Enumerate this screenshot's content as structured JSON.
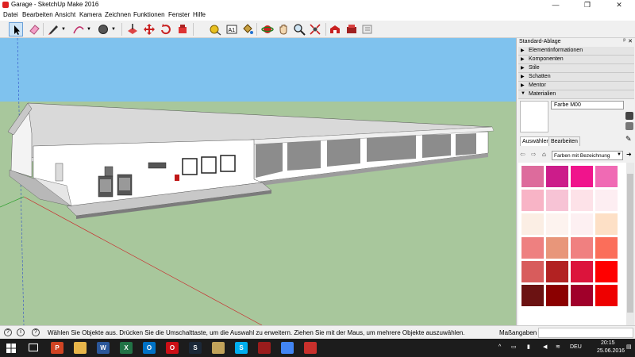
{
  "window": {
    "title": "Garage - SketchUp Make 2016",
    "minimize": "—",
    "maximize": "❐",
    "close": "✕"
  },
  "menu": [
    "Datei",
    "Bearbeiten",
    "Ansicht",
    "Kamera",
    "Zeichnen",
    "Funktionen",
    "Fenster",
    "Hilfe"
  ],
  "toolbar": {
    "tools": [
      "select-tool",
      "eraser-tool",
      "line-tool",
      "arc-tool",
      "shapes-tool",
      "push-pull-tool",
      "move-tool",
      "rotate-tool",
      "follow-me-tool",
      "tape-measure-tool",
      "text-tool",
      "paint-bucket-tool",
      "orbit-tool",
      "pan-tool",
      "zoom-tool",
      "zoom-extents-tool",
      "warehouse-tool",
      "extension-warehouse-tool",
      "layout-tool"
    ],
    "text_tool_label": "A1"
  },
  "tray": {
    "title": "Standard-Ablage",
    "pin": "ᵖ",
    "close": "✕",
    "sections": [
      {
        "label": "Elementinformationen",
        "state": "collapsed"
      },
      {
        "label": "Komponenten",
        "state": "collapsed"
      },
      {
        "label": "Stile",
        "state": "collapsed"
      },
      {
        "label": "Schatten",
        "state": "collapsed"
      },
      {
        "label": "Mentor",
        "state": "collapsed"
      },
      {
        "label": "Materialien",
        "state": "expanded"
      }
    ],
    "material_name": "Farbe M00",
    "tabs": [
      "Auswählen",
      "Bearbeiten"
    ],
    "library": "Farben mit Bezeichnung",
    "swatches": [
      "#dd6b9c",
      "#cc1c8a",
      "#f0148c",
      "#f06ab4",
      "#f8b4c6",
      "#f7c3d5",
      "#fde2e8",
      "#fdeef2",
      "#fbeee4",
      "#fdf3ef",
      "#fdf0f2",
      "#fde0c6",
      "#ee8080",
      "#e8967a",
      "#f08080",
      "#fb6e5a",
      "#d85c5c",
      "#b22222",
      "#dc143c",
      "#ff0000",
      "#6b1212",
      "#8b0000",
      "#a0002a",
      "#ee0000"
    ]
  },
  "status": {
    "text": "Wählen Sie Objekte aus. Drücken Sie die Umschalttaste, um die Auswahl zu erweitern. Ziehen Sie mit der Maus, um mehrere Objekte auszuwählen.",
    "measure_label": "Maßangaben",
    "help_glyph": "?",
    "info_glyph": "i"
  },
  "taskbar": {
    "time": "20:15",
    "date": "25.06.2016",
    "lang": "DEU",
    "apps": [
      {
        "name": "powerpoint",
        "color": "#d04423",
        "glyph": "P"
      },
      {
        "name": "file-explorer",
        "color": "#e8b64a",
        "glyph": ""
      },
      {
        "name": "word",
        "color": "#2b579a",
        "glyph": "W"
      },
      {
        "name": "excel",
        "color": "#217346",
        "glyph": "X"
      },
      {
        "name": "outlook",
        "color": "#0072c6",
        "glyph": "O"
      },
      {
        "name": "opera",
        "color": "#cc0f16",
        "glyph": "O"
      },
      {
        "name": "steam",
        "color": "#1b2838",
        "glyph": "S"
      },
      {
        "name": "paint",
        "color": "#c2a35a",
        "glyph": ""
      },
      {
        "name": "skype",
        "color": "#00aff0",
        "glyph": "S"
      },
      {
        "name": "app-red",
        "color": "#9a1c1c",
        "glyph": ""
      },
      {
        "name": "chrome",
        "color": "#4285f4",
        "glyph": ""
      },
      {
        "name": "sketchup",
        "color": "#c9302c",
        "glyph": ""
      }
    ]
  },
  "colors": {
    "sky": "#7fc2ee",
    "ground": "#a8c79c",
    "axis_red": "#c83030",
    "axis_green": "#2fa02f",
    "axis_blue": "#3050c8"
  }
}
